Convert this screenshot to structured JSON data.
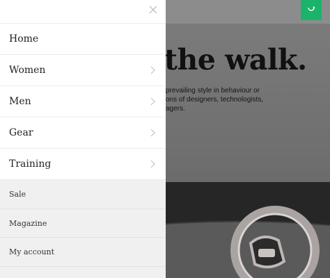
{
  "drawer": {
    "nav": [
      {
        "label": "Home",
        "has_children": false
      },
      {
        "label": "Women",
        "has_children": true
      },
      {
        "label": "Men",
        "has_children": true
      },
      {
        "label": "Gear",
        "has_children": true
      },
      {
        "label": "Training",
        "has_children": true
      }
    ],
    "secondary": [
      {
        "label": "Sale"
      },
      {
        "label": "Magazine"
      },
      {
        "label": "My account"
      }
    ]
  },
  "hero": {
    "title": "the walk.",
    "text": "prevailing style in behaviour or\nons of designers, technologists,\nagers."
  },
  "colors": {
    "accent": "#1bb36a",
    "drawer_bg": "#ffffff",
    "secondary_bg": "#f0f0f0"
  },
  "icons": {
    "close": "close-icon",
    "chevron": "chevron-right-icon",
    "cart": "shopping-bag-icon"
  }
}
